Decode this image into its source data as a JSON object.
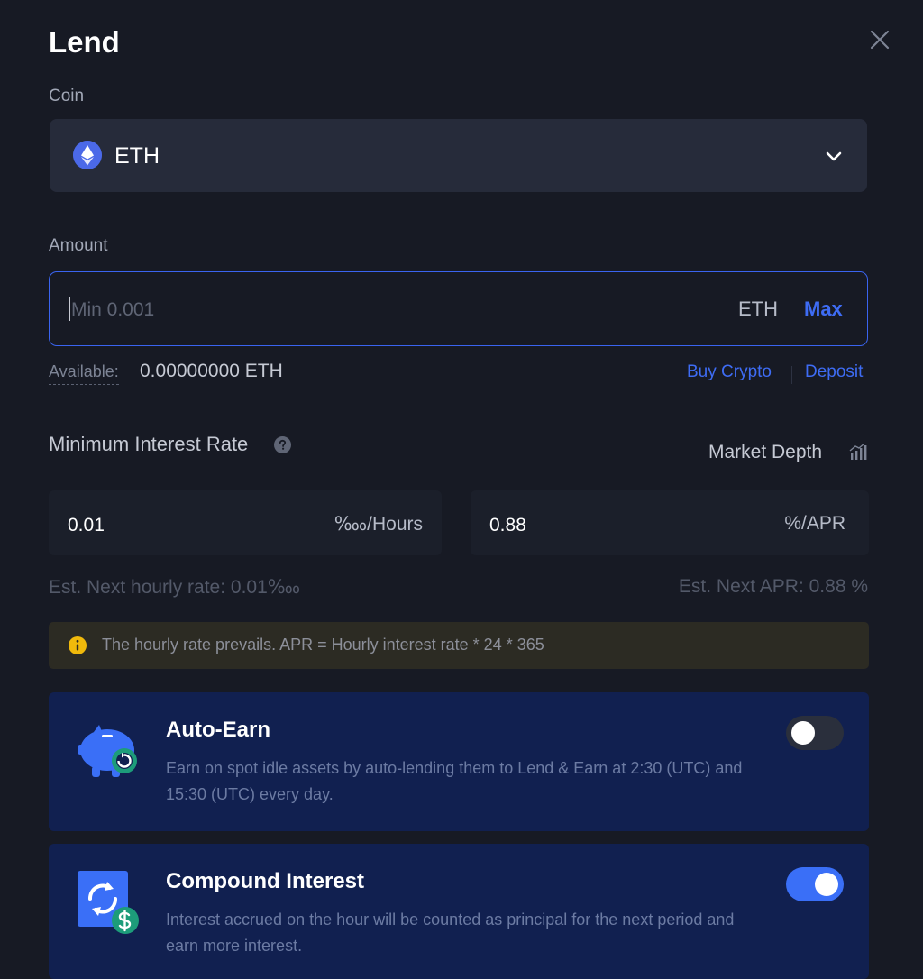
{
  "dialog": {
    "title": "Lend"
  },
  "coin": {
    "label": "Coin",
    "selected": "ETH"
  },
  "amount": {
    "label": "Amount",
    "placeholder": "Min 0.001",
    "unit": "ETH",
    "max_label": "Max",
    "available_label": "Available:",
    "available_value": "0.00000000 ETH",
    "buy_crypto": "Buy Crypto",
    "deposit": "Deposit"
  },
  "interest": {
    "title": "Minimum Interest Rate",
    "market_depth": "Market Depth",
    "hourly_value": "0.01",
    "hourly_unit": "‱/Hours",
    "apr_value": "0.88",
    "apr_unit": "%/APR",
    "est_hourly": "Est. Next hourly rate: 0.01‱",
    "est_apr": "Est. Next APR: 0.88 %"
  },
  "notice": {
    "text": "The hourly rate prevails. APR = Hourly interest rate * 24 * 365"
  },
  "auto_earn": {
    "title": "Auto-Earn",
    "description": "Earn on spot idle assets by auto-lending them to Lend & Earn at 2:30 (UTC) and 15:30 (UTC) every day.",
    "enabled": false
  },
  "compound": {
    "title": "Compound Interest",
    "description": "Interest accrued on the hour will be counted as principal for the next period and earn more interest.",
    "enabled": true
  },
  "colors": {
    "background": "#171a24",
    "accent": "#3e6cf4",
    "card": "#112050",
    "notice_bg": "#2c2b23",
    "warning": "#f0b90b"
  }
}
